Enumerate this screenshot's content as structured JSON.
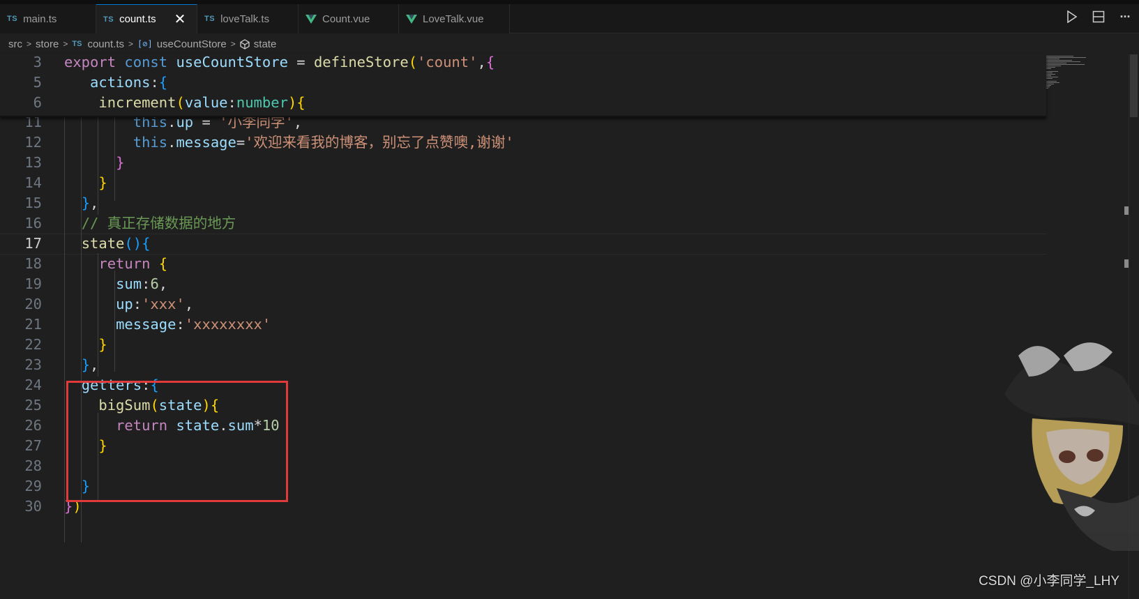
{
  "tabs": [
    {
      "label": "main.ts",
      "icon": "ts-icon",
      "active": false
    },
    {
      "label": "count.ts",
      "icon": "ts-icon",
      "active": true
    },
    {
      "label": "loveTalk.ts",
      "icon": "ts-icon",
      "active": false
    },
    {
      "label": "Count.vue",
      "icon": "vue-icon",
      "active": false
    },
    {
      "label": "LoveTalk.vue",
      "icon": "vue-icon",
      "active": false
    }
  ],
  "tab_icons": {
    "ts": "TS",
    "close": "✕"
  },
  "toolbar_actions": [
    "run-icon",
    "split-editor-icon",
    "more-actions-icon"
  ],
  "toolbar_glyphs": {
    "more": "···"
  },
  "breadcrumb": {
    "items": [
      "src",
      "store",
      "count.ts",
      "useCountStore",
      "state"
    ],
    "ts_badge": "TS",
    "symbol_glyph": "[⊘]"
  },
  "current_line": "17",
  "sticky_lines": [
    {
      "n": "3",
      "tokens": [
        [
          "kw2",
          "export "
        ],
        [
          "kw",
          "const "
        ],
        [
          "var",
          "useCountStore"
        ],
        [
          "p",
          " = "
        ],
        [
          "fn",
          "defineStore"
        ],
        [
          "b1",
          "("
        ],
        [
          "str",
          "'count'"
        ],
        [
          "p",
          ","
        ],
        [
          "b2",
          "{"
        ]
      ]
    },
    {
      "n": "5",
      "tokens": [
        [
          "p",
          "   "
        ],
        [
          "var",
          "actions"
        ],
        [
          "p",
          ":"
        ],
        [
          "b3",
          "{"
        ]
      ]
    },
    {
      "n": "6",
      "tokens": [
        [
          "p",
          "    "
        ],
        [
          "fn",
          "increment"
        ],
        [
          "b1",
          "("
        ],
        [
          "var",
          "value"
        ],
        [
          "p",
          ":"
        ],
        [
          "type",
          "number"
        ],
        [
          "b1",
          ")"
        ],
        [
          "b1",
          "{"
        ]
      ]
    }
  ],
  "lines": [
    {
      "n": "11",
      "tokens": [
        [
          "p",
          "        "
        ],
        [
          "kw",
          "this"
        ],
        [
          "p",
          "."
        ],
        [
          "var",
          "up"
        ],
        [
          "p",
          " = "
        ],
        [
          "str",
          "'小李同学'"
        ],
        [
          "p",
          ","
        ]
      ]
    },
    {
      "n": "12",
      "tokens": [
        [
          "p",
          "        "
        ],
        [
          "kw",
          "this"
        ],
        [
          "p",
          "."
        ],
        [
          "var",
          "message"
        ],
        [
          "p",
          "="
        ],
        [
          "str",
          "'欢迎来看我的博客，别忘了点赞噢,谢谢'"
        ]
      ]
    },
    {
      "n": "13",
      "tokens": [
        [
          "p",
          "      "
        ],
        [
          "b2",
          "}"
        ]
      ]
    },
    {
      "n": "14",
      "tokens": [
        [
          "p",
          "    "
        ],
        [
          "b1",
          "}"
        ]
      ]
    },
    {
      "n": "15",
      "tokens": [
        [
          "p",
          "  "
        ],
        [
          "b3",
          "}"
        ],
        [
          "p",
          ","
        ]
      ]
    },
    {
      "n": "16",
      "tokens": [
        [
          "p",
          "  "
        ],
        [
          "cmt",
          "// 真正存储数据的地方"
        ]
      ]
    },
    {
      "n": "17",
      "tokens": [
        [
          "p",
          "  "
        ],
        [
          "fn",
          "state"
        ],
        [
          "b3",
          "()"
        ],
        [
          "b3",
          "{"
        ]
      ]
    },
    {
      "n": "18",
      "tokens": [
        [
          "p",
          "    "
        ],
        [
          "kw2",
          "return "
        ],
        [
          "b1",
          "{"
        ]
      ]
    },
    {
      "n": "19",
      "tokens": [
        [
          "p",
          "      "
        ],
        [
          "var",
          "sum"
        ],
        [
          "p",
          ":"
        ],
        [
          "num",
          "6"
        ],
        [
          "p",
          ","
        ]
      ]
    },
    {
      "n": "20",
      "tokens": [
        [
          "p",
          "      "
        ],
        [
          "var",
          "up"
        ],
        [
          "p",
          ":"
        ],
        [
          "str",
          "'xxx'"
        ],
        [
          "p",
          ","
        ]
      ]
    },
    {
      "n": "21",
      "tokens": [
        [
          "p",
          "      "
        ],
        [
          "var",
          "message"
        ],
        [
          "p",
          ":"
        ],
        [
          "str",
          "'xxxxxxxx'"
        ]
      ]
    },
    {
      "n": "22",
      "tokens": [
        [
          "p",
          "    "
        ],
        [
          "b1",
          "}"
        ]
      ]
    },
    {
      "n": "23",
      "tokens": [
        [
          "p",
          "  "
        ],
        [
          "b3",
          "}"
        ],
        [
          "p",
          ","
        ]
      ]
    },
    {
      "n": "24",
      "tokens": [
        [
          "p",
          "  "
        ],
        [
          "var",
          "getters"
        ],
        [
          "p",
          ":"
        ],
        [
          "b3",
          "{"
        ]
      ]
    },
    {
      "n": "25",
      "tokens": [
        [
          "p",
          "    "
        ],
        [
          "fn",
          "bigSum"
        ],
        [
          "b1",
          "("
        ],
        [
          "var",
          "state"
        ],
        [
          "b1",
          ")"
        ],
        [
          "b1",
          "{"
        ]
      ]
    },
    {
      "n": "26",
      "tokens": [
        [
          "p",
          "      "
        ],
        [
          "kw2",
          "return "
        ],
        [
          "var",
          "state"
        ],
        [
          "p",
          "."
        ],
        [
          "var",
          "sum"
        ],
        [
          "p",
          "*"
        ],
        [
          "num",
          "10"
        ]
      ]
    },
    {
      "n": "27",
      "tokens": [
        [
          "p",
          "    "
        ],
        [
          "b1",
          "}"
        ]
      ]
    },
    {
      "n": "28",
      "tokens": []
    },
    {
      "n": "29",
      "tokens": [
        [
          "p",
          "  "
        ],
        [
          "b3",
          "}"
        ]
      ]
    },
    {
      "n": "30",
      "tokens": [
        [
          "b2",
          "}"
        ],
        [
          "b1",
          ")"
        ]
      ]
    }
  ],
  "watermark": "CSDN @小李同学_LHY",
  "colors": {
    "accent": "#0078d4",
    "highlight_box": "#e03a3a",
    "background": "#1f1f1f"
  }
}
